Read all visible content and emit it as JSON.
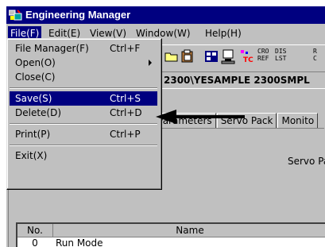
{
  "window": {
    "title": "Engineering Manager"
  },
  "menubar": {
    "items": [
      {
        "label": "File(F)"
      },
      {
        "label": "Edit(E)"
      },
      {
        "label": "View(V)"
      },
      {
        "label": "Window(W)"
      },
      {
        "label": "Help(H)"
      }
    ]
  },
  "toolbar": {
    "cro_ref": "CRO\nREF",
    "dis_lst": "DIS\nLST",
    "extra": "R\nC"
  },
  "path": {
    "text": "2300\\YESAMPLE  2300SMPL"
  },
  "content": {
    "servo_label": "Servo Pa",
    "tabs": [
      "Parameters",
      "Servo Pack",
      "Monito"
    ],
    "table": {
      "headers": [
        "No.",
        "Name"
      ],
      "rows": [
        {
          "no": "0",
          "name": "Run Mode"
        }
      ]
    }
  },
  "file_menu": {
    "items": [
      {
        "label": "File Manager(F)",
        "shortcut": "Ctrl+F"
      },
      {
        "label": "Open(O)",
        "shortcut": ""
      },
      {
        "label": "Close(C)",
        "shortcut": ""
      },
      {
        "label": "Save(S)",
        "shortcut": "Ctrl+S"
      },
      {
        "label": "Delete(D)",
        "shortcut": "Ctrl+D"
      },
      {
        "label": "Print(P)",
        "shortcut": "Ctrl+P"
      },
      {
        "label": "Exit(X)",
        "shortcut": ""
      }
    ],
    "selected": "Save(S)"
  },
  "colors": {
    "titlebar": "#000080",
    "face": "#c0c0c0",
    "highlight": "#000080"
  }
}
